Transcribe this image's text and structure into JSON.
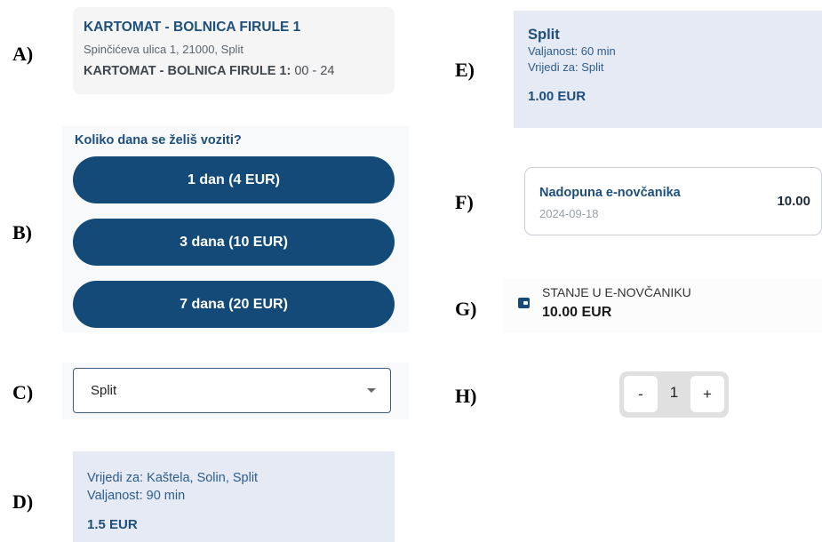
{
  "labels": {
    "a": "A)",
    "b": "B)",
    "c": "C)",
    "d": "D)",
    "e": "E)",
    "f": "F)",
    "g": "G)",
    "h": "H)"
  },
  "panel_a": {
    "title": "KARTOMAT - BOLNICA FIRULE 1",
    "address": "Spinčićeva ulica 1, 21000, Split",
    "hours_label": "KARTOMAT - BOLNICA FIRULE 1:",
    "hours_value": " 00 - 24"
  },
  "panel_b": {
    "question": "Koliko dana se želiš voziti?",
    "options": [
      "1 dan (4 EUR)",
      "3 dana (10 EUR)",
      "7 dana (20 EUR)"
    ]
  },
  "panel_c": {
    "selected": "Split",
    "icon": "chevron-down-icon"
  },
  "panel_d": {
    "valid_for": "Vrijedi za: Kaštela, Solin, Split",
    "validity": "Valjanost: 90 min",
    "price": "1.5 EUR"
  },
  "panel_e": {
    "title": "Split",
    "validity": "Valjanost: 60 min",
    "valid_for": "Vrijedi za: Split",
    "price": "1.00 EUR"
  },
  "panel_f": {
    "title": "Nadopuna e-novčanika",
    "date": "2024-09-18",
    "amount": "10.00"
  },
  "panel_g": {
    "icon": "wallet-icon",
    "label": "STANJE U E-NOVČANIKU",
    "amount": "10.00 EUR"
  },
  "panel_h": {
    "minus": "-",
    "value": "1",
    "plus": "+"
  },
  "colors": {
    "primary": "#134a78",
    "card_bg": "#e6eaf5",
    "stepper_bg": "#e0e0e0"
  }
}
